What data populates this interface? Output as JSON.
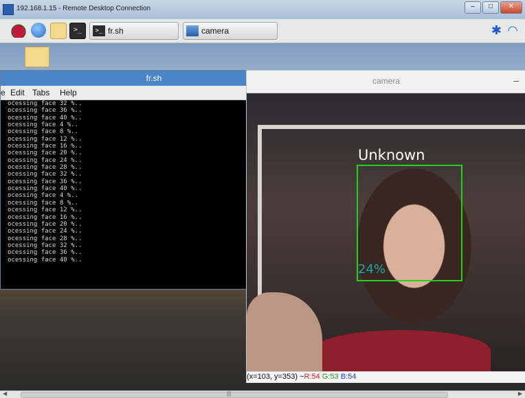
{
  "rdp_window": {
    "title": "192.168.1.15 - Remote Desktop Connection"
  },
  "taskbar": {
    "tasks": [
      {
        "label": "fr.sh"
      },
      {
        "label": "camera"
      }
    ],
    "terminal_glyph": ">_"
  },
  "terminal": {
    "title": "fr.sh",
    "menu": [
      "e",
      "Edit",
      "Tabs",
      "Help"
    ],
    "lines": [
      "ocessing face 32 %..",
      "ocessing face 36 %..",
      "ocessing face 40 %..",
      "ocessing face 4 %..",
      "ocessing face 8 %..",
      "ocessing face 12 %..",
      "ocessing face 16 %..",
      "ocessing face 20 %..",
      "ocessing face 24 %..",
      "ocessing face 28 %..",
      "ocessing face 32 %..",
      "ocessing face 36 %..",
      "ocessing face 40 %..",
      "ocessing face 4 %..",
      "ocessing face 8 %..",
      "ocessing face 12 %..",
      "ocessing face 16 %..",
      "ocessing face 20 %..",
      "ocessing face 24 %..",
      "ocessing face 28 %..",
      "ocessing face 32 %..",
      "ocessing face 36 %..",
      "ocessing face 40 %.."
    ]
  },
  "camera": {
    "title": "camera",
    "detection": {
      "label": "Unknown",
      "confidence": "24%"
    },
    "status": {
      "coords": "(x=103, y=353) ~ ",
      "r": "R:54",
      "g": "G:53",
      "b": "B:54"
    }
  },
  "colors": {
    "detection_box": "#22d11e",
    "confidence_text": "#1ca6a6",
    "rgb_r": "#e02020",
    "rgb_g": "#20a020",
    "rgb_b": "#2040e0"
  },
  "icons": [
    "raspberry-menu-icon",
    "web-browser-icon",
    "file-manager-icon",
    "terminal-icon",
    "bluetooth-icon",
    "wifi-icon",
    "folder-icon"
  ]
}
